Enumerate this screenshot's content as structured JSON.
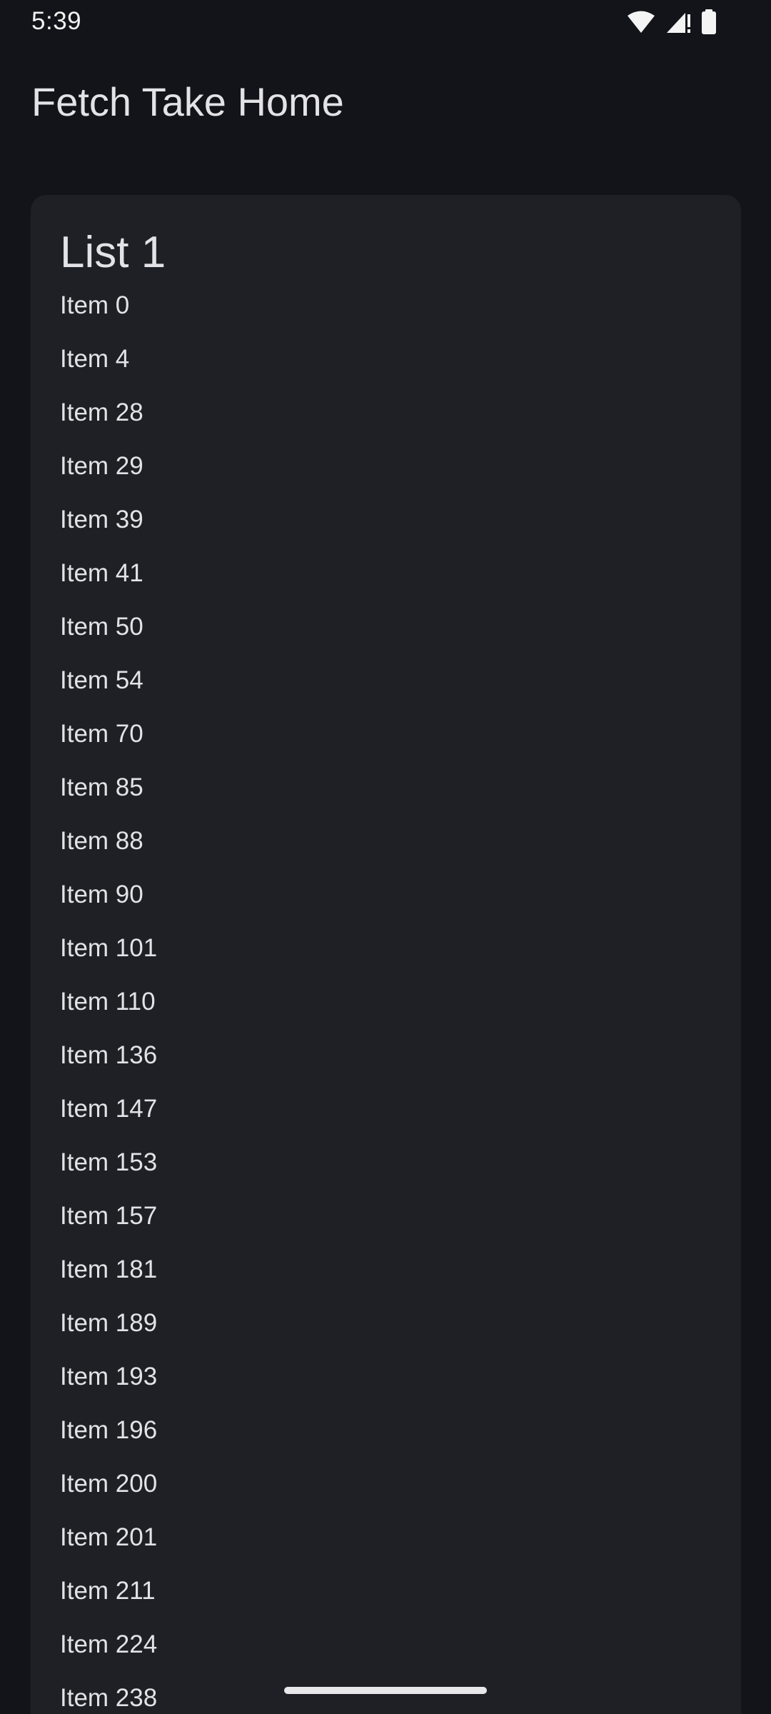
{
  "status_bar": {
    "time": "5:39",
    "icons": [
      "wifi-icon",
      "signal-icon",
      "battery-icon"
    ]
  },
  "app_bar": {
    "title": "Fetch Take Home"
  },
  "list": {
    "title": "List 1",
    "items": [
      "Item 0",
      "Item 4",
      "Item 28",
      "Item 29",
      "Item 39",
      "Item 41",
      "Item 50",
      "Item 54",
      "Item 70",
      "Item 85",
      "Item 88",
      "Item 90",
      "Item 101",
      "Item 110",
      "Item 136",
      "Item 147",
      "Item 153",
      "Item 157",
      "Item 181",
      "Item 189",
      "Item 193",
      "Item 196",
      "Item 200",
      "Item 201",
      "Item 211",
      "Item 224",
      "Item 238"
    ]
  },
  "colors": {
    "background": "#131419",
    "card": "#1f2025",
    "text": "#e3e2e6"
  }
}
